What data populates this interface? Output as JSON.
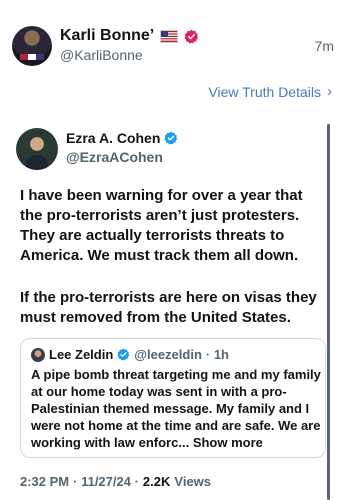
{
  "header": {
    "display_name": "Karli Bonne’",
    "handle": "@KarliBonne",
    "timestamp": "7m",
    "flag_icon": "us-flag-icon",
    "verified_color": "#e0245e"
  },
  "details_link": {
    "label": "View Truth Details",
    "chevron": "›"
  },
  "quoted_post": {
    "author_name": "Ezra A. Cohen",
    "author_handle": "@EzraACohen",
    "verified_color": "#1d9bf0",
    "paragraphs": [
      "I have been warning for over a year that the pro-terrorists aren’t just protesters. They are actually terrorists threats to America. We must track them all down.",
      "If the pro-terrorists are here on visas they must removed from the United States."
    ],
    "nested_quote": {
      "author_name": "Lee Zeldin",
      "author_handle": "@leezeldin",
      "time": "· 1h",
      "text": "A pipe bomb threat targeting me and my family at our home today was sent in with a pro-Palestinian themed message. My family and I were not home at the time and are safe. We are working with law enforc...",
      "show_more": "Show more"
    },
    "meta": {
      "time": "2:32 PM",
      "date": "· 11/27/24 ·",
      "views_count": "2.2K",
      "views_label": "Views"
    }
  }
}
